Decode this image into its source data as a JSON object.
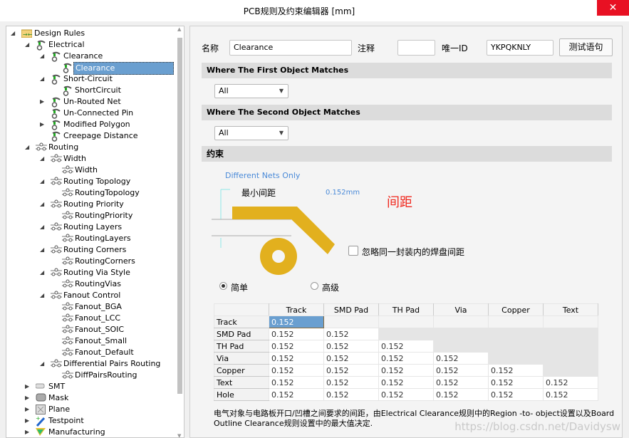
{
  "window": {
    "title": "PCB规则及约束编辑器 [mm]",
    "close_icon": "close-icon"
  },
  "tree": [
    {
      "level": 0,
      "label": "Design Rules",
      "toggle": "expanded",
      "icon": "rules-folder"
    },
    {
      "level": 1,
      "label": "Electrical",
      "toggle": "expanded",
      "icon": "electrical"
    },
    {
      "level": 2,
      "label": "Clearance",
      "toggle": "expanded",
      "icon": "electrical"
    },
    {
      "level": 3,
      "label": "Clearance",
      "toggle": "none",
      "icon": "electrical",
      "selected": true
    },
    {
      "level": 2,
      "label": "Short-Circuit",
      "toggle": "expanded",
      "icon": "electrical"
    },
    {
      "level": 3,
      "label": "ShortCircuit",
      "toggle": "none",
      "icon": "electrical"
    },
    {
      "level": 2,
      "label": "Un-Routed Net",
      "toggle": "collapsed",
      "icon": "electrical"
    },
    {
      "level": 2,
      "label": "Un-Connected Pin",
      "toggle": "none",
      "icon": "electrical"
    },
    {
      "level": 2,
      "label": "Modified Polygon",
      "toggle": "collapsed",
      "icon": "electrical"
    },
    {
      "level": 2,
      "label": "Creepage Distance",
      "toggle": "none",
      "icon": "electrical"
    },
    {
      "level": 1,
      "label": "Routing",
      "toggle": "expanded",
      "icon": "routing"
    },
    {
      "level": 2,
      "label": "Width",
      "toggle": "expanded",
      "icon": "routing"
    },
    {
      "level": 3,
      "label": "Width",
      "toggle": "none",
      "icon": "routing"
    },
    {
      "level": 2,
      "label": "Routing Topology",
      "toggle": "expanded",
      "icon": "routing"
    },
    {
      "level": 3,
      "label": "RoutingTopology",
      "toggle": "none",
      "icon": "routing"
    },
    {
      "level": 2,
      "label": "Routing Priority",
      "toggle": "expanded",
      "icon": "routing"
    },
    {
      "level": 3,
      "label": "RoutingPriority",
      "toggle": "none",
      "icon": "routing"
    },
    {
      "level": 2,
      "label": "Routing Layers",
      "toggle": "expanded",
      "icon": "routing"
    },
    {
      "level": 3,
      "label": "RoutingLayers",
      "toggle": "none",
      "icon": "routing"
    },
    {
      "level": 2,
      "label": "Routing Corners",
      "toggle": "expanded",
      "icon": "routing"
    },
    {
      "level": 3,
      "label": "RoutingCorners",
      "toggle": "none",
      "icon": "routing"
    },
    {
      "level": 2,
      "label": "Routing Via Style",
      "toggle": "expanded",
      "icon": "routing"
    },
    {
      "level": 3,
      "label": "RoutingVias",
      "toggle": "none",
      "icon": "routing"
    },
    {
      "level": 2,
      "label": "Fanout Control",
      "toggle": "expanded",
      "icon": "routing"
    },
    {
      "level": 3,
      "label": "Fanout_BGA",
      "toggle": "none",
      "icon": "routing"
    },
    {
      "level": 3,
      "label": "Fanout_LCC",
      "toggle": "none",
      "icon": "routing"
    },
    {
      "level": 3,
      "label": "Fanout_SOIC",
      "toggle": "none",
      "icon": "routing"
    },
    {
      "level": 3,
      "label": "Fanout_Small",
      "toggle": "none",
      "icon": "routing"
    },
    {
      "level": 3,
      "label": "Fanout_Default",
      "toggle": "none",
      "icon": "routing"
    },
    {
      "level": 2,
      "label": "Differential Pairs Routing",
      "toggle": "expanded",
      "icon": "routing"
    },
    {
      "level": 3,
      "label": "DiffPairsRouting",
      "toggle": "none",
      "icon": "routing"
    },
    {
      "level": 1,
      "label": "SMT",
      "toggle": "collapsed",
      "icon": "smt"
    },
    {
      "level": 1,
      "label": "Mask",
      "toggle": "collapsed",
      "icon": "mask"
    },
    {
      "level": 1,
      "label": "Plane",
      "toggle": "collapsed",
      "icon": "plane"
    },
    {
      "level": 1,
      "label": "Testpoint",
      "toggle": "collapsed",
      "icon": "testpoint"
    },
    {
      "level": 1,
      "label": "Manufacturing",
      "toggle": "collapsed",
      "icon": "manufacturing"
    }
  ],
  "form": {
    "name_label": "名称",
    "name_value": "Clearance",
    "comment_label": "注释",
    "comment_value": "",
    "id_label": "唯一ID",
    "id_value": "YKPQKNLY",
    "test_button": "测试语句",
    "first_match_header": "Where The First Object Matches",
    "first_match_value": "All",
    "second_match_header": "Where The Second Object Matches",
    "second_match_value": "All",
    "constraints_header": "约束"
  },
  "diagram": {
    "net_scope": "Different Nets Only",
    "min_clearance_label": "最小间距",
    "min_clearance_value": "0.152mm",
    "annotation": "间距",
    "ignore_pads_label": "忽略同一封装内的焊盘间距",
    "ignore_pads_checked": false,
    "copper_color": "#e2b01e",
    "annotation_color": "#f0281e"
  },
  "mode": {
    "simple": "简单",
    "advanced": "高级",
    "selected": "simple"
  },
  "matrix": {
    "columns": [
      "Track",
      "SMD Pad",
      "TH Pad",
      "Via",
      "Copper",
      "Text"
    ],
    "rows": [
      {
        "label": "Track",
        "values": [
          "0.152"
        ]
      },
      {
        "label": "SMD Pad",
        "values": [
          "0.152",
          "0.152"
        ]
      },
      {
        "label": "TH Pad",
        "values": [
          "0.152",
          "0.152",
          "0.152"
        ]
      },
      {
        "label": "Via",
        "values": [
          "0.152",
          "0.152",
          "0.152",
          "0.152"
        ]
      },
      {
        "label": "Copper",
        "values": [
          "0.152",
          "0.152",
          "0.152",
          "0.152",
          "0.152"
        ]
      },
      {
        "label": "Text",
        "values": [
          "0.152",
          "0.152",
          "0.152",
          "0.152",
          "0.152",
          "0.152"
        ]
      },
      {
        "label": "Hole",
        "values": [
          "0.152",
          "0.152",
          "0.152",
          "0.152",
          "0.152",
          "0.152"
        ]
      }
    ]
  },
  "description": "电气对象与电路板开口/凹槽之间要求的间距，由Electrical Clearance规则中的Region -to- object设置以及Board Outline Clearance规则设置中的最大值决定.",
  "watermark": "https://blog.csdn.net/Davidysw"
}
